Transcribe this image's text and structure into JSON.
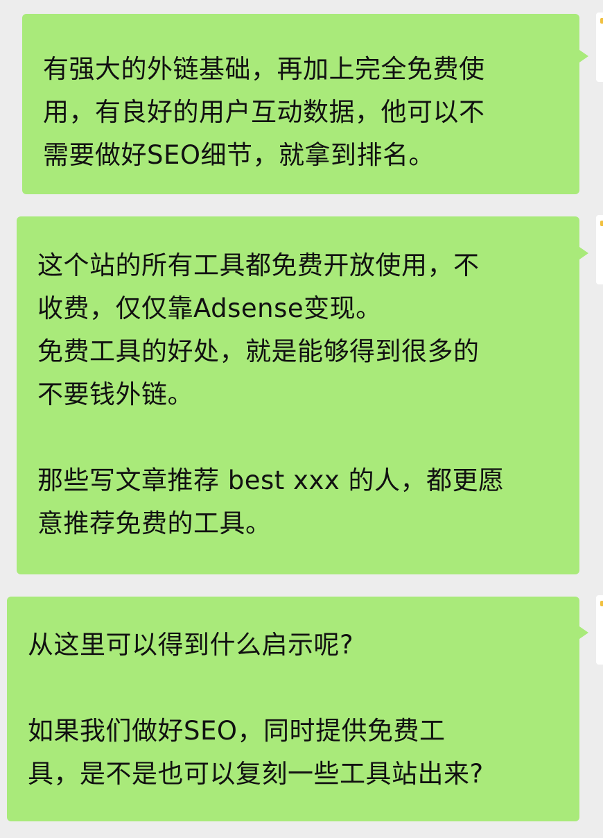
{
  "chat": {
    "messages": [
      {
        "lines": [
          "有强大的外链基础，再加上完全免费使",
          "用，有良好的用户互动数据，他可以不",
          "需要做好SEO细节，就拿到排名。"
        ]
      },
      {
        "lines": [
          "这个站的所有工具都免费开放使用，不",
          "收费，仅仅靠Adsense变现。",
          "免费工具的好处，就是能够得到很多的",
          "不要钱外链。",
          "",
          "那些写文章推荐 best xxx 的人，都更愿",
          "意推荐免费的工具。"
        ]
      },
      {
        "lines": [
          "从这里可以得到什么启示呢?",
          "",
          "如果我们做好SEO，同时提供免费工",
          "具，是不是也可以复刻一些工具站出来?"
        ]
      }
    ]
  },
  "colors": {
    "bubble": "#a9ea7a",
    "background": "#ededed",
    "text": "#111111"
  }
}
